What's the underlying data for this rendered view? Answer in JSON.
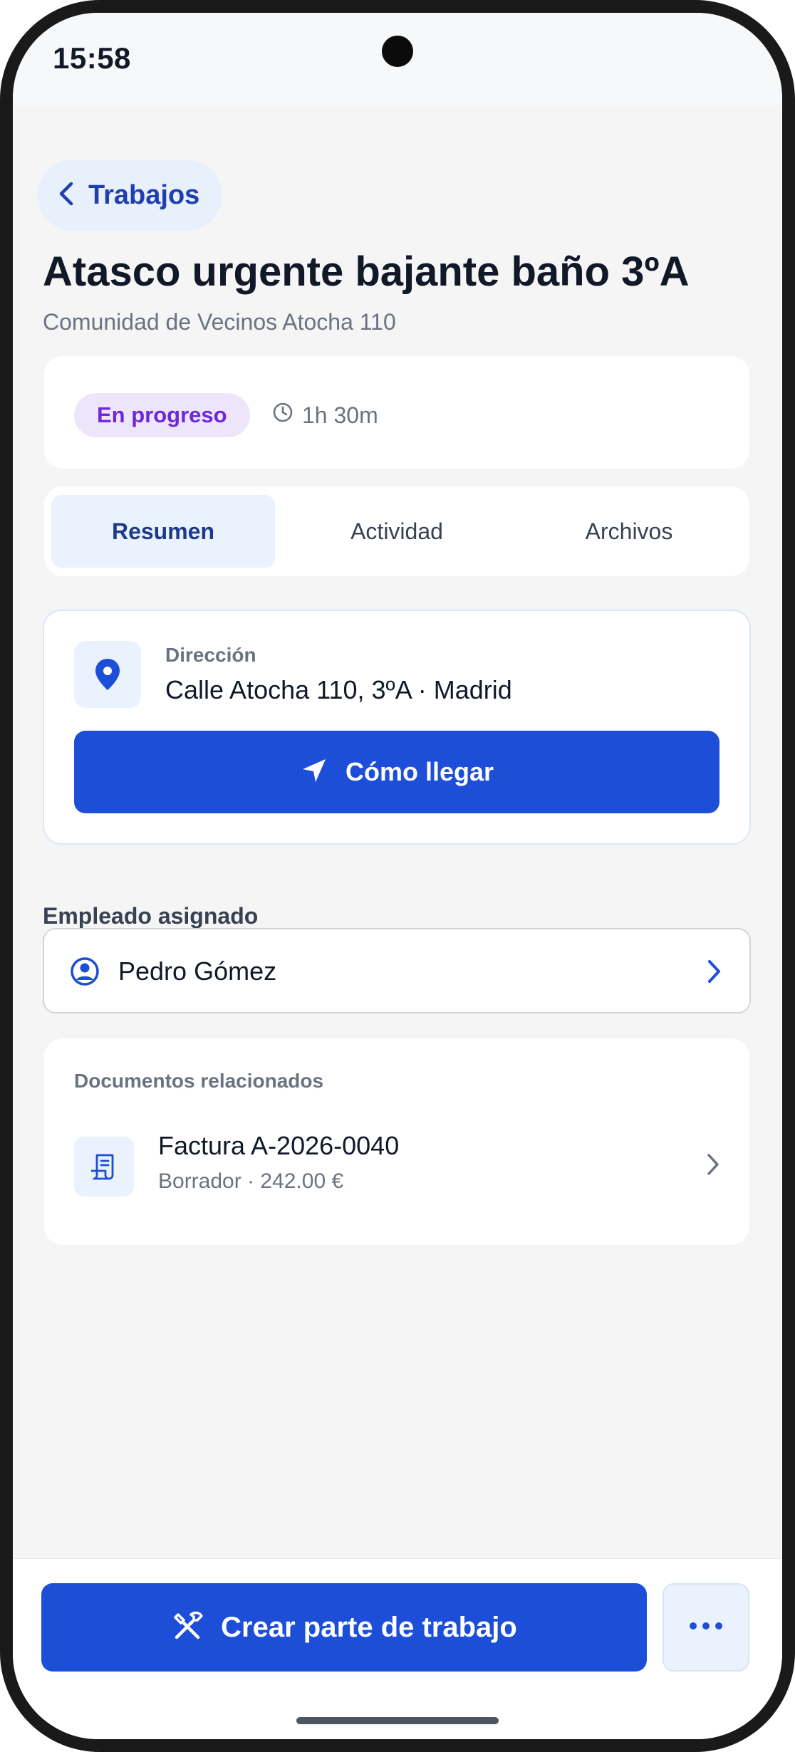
{
  "status_bar": {
    "time": "15:58"
  },
  "header": {
    "back_label": "Trabajos",
    "title": "Atasco urgente bajante baño 3ºA",
    "subtitle": "Comunidad de Vecinos Atocha 110"
  },
  "status": {
    "badge": "En progreso",
    "badge_color": "#6d28d9",
    "duration": "1h 30m"
  },
  "tabs": [
    {
      "label": "Resumen",
      "active": true
    },
    {
      "label": "Actividad",
      "active": false
    },
    {
      "label": "Archivos",
      "active": false
    }
  ],
  "address": {
    "label": "Dirección",
    "value": "Calle Atocha 110, 3ºA · Madrid",
    "button_label": "Cómo llegar"
  },
  "employee": {
    "section_label": "Empleado asignado",
    "name": "Pedro Gómez"
  },
  "documents": {
    "title": "Documentos relacionados",
    "items": [
      {
        "name": "Factura A-2026-0040",
        "meta": "Borrador · 242.00 €"
      }
    ]
  },
  "actions": {
    "primary_label": "Crear parte de trabajo",
    "more_icon": "more-horizontal-icon"
  },
  "colors": {
    "accent": "#1d4ed8",
    "accent_light": "#eaf2fd"
  }
}
